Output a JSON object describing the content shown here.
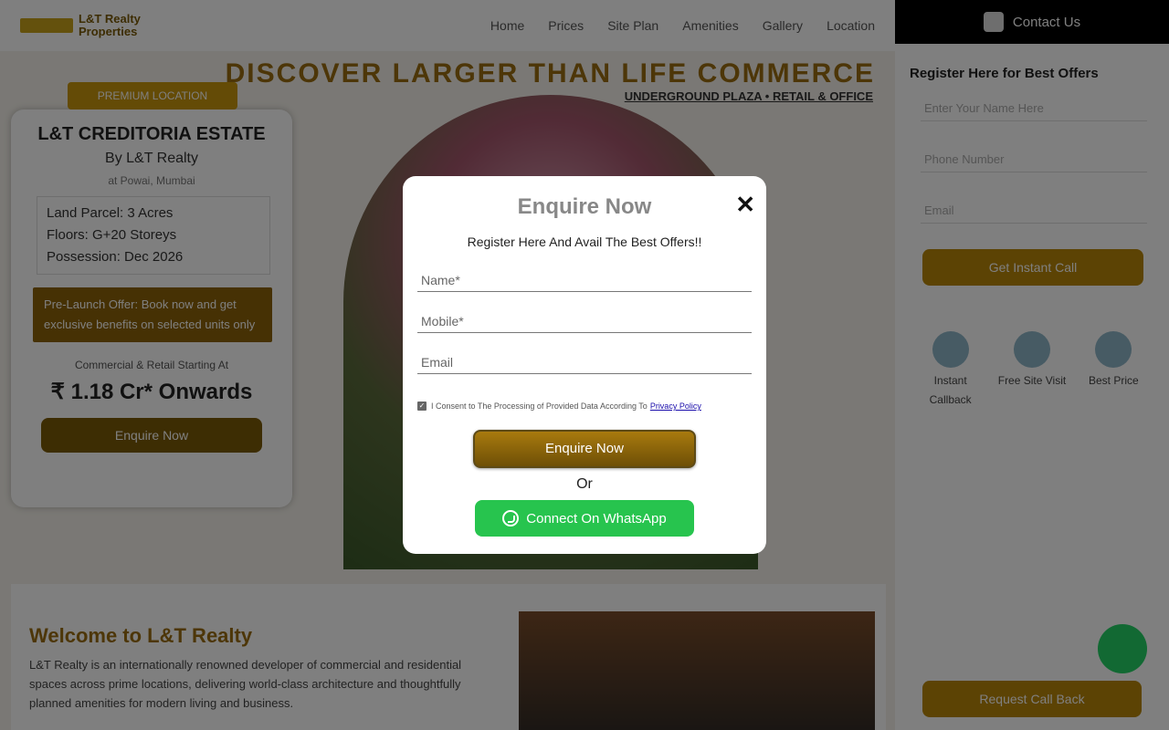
{
  "background": {
    "nav": {
      "logo_text": "L&T Realty\nProperties",
      "links": [
        "Home",
        "Prices",
        "Site Plan",
        "Amenities",
        "Gallery",
        "Location"
      ]
    },
    "hero": {
      "title": "DISCOVER LARGER THAN LIFE COMMERCE",
      "subtitle": "UNDERGROUND PLAZA • RETAIL & OFFICE"
    },
    "card": {
      "tag": "PREMIUM LOCATION",
      "title": "L&T CREDITORIA ESTATE",
      "subtitle": "By L&T Realty",
      "location": "at Powai, Mumbai",
      "details": [
        "Land Parcel: 3 Acres",
        "Floors: G+20 Storeys",
        "Possession: Dec 2026"
      ],
      "offer": "Pre-Launch Offer: Book now and get exclusive benefits on selected units only",
      "price_label": "Commercial & Retail Starting At",
      "price": "₹ 1.18 Cr* Onwards",
      "button": "Enquire Now"
    },
    "about": {
      "heading": "Welcome to L&T Realty",
      "text": "L&T Realty is an internationally renowned developer of commercial and residential spaces across prime locations, delivering world-class architecture and thoughtfully planned amenities for modern living and business."
    }
  },
  "side": {
    "header": "Contact Us",
    "heading": "Register Here for Best Offers",
    "name_placeholder": "Enter Your Name Here",
    "phone_placeholder": "Phone Number",
    "email_placeholder": "Email",
    "button": "Get Instant Call",
    "icons": [
      {
        "label": "Instant Callback",
        "icon": "callback-icon"
      },
      {
        "label": "Free Site Visit",
        "icon": "car-icon"
      },
      {
        "label": "Best Price",
        "icon": "tag-icon"
      }
    ],
    "bottom_button": "Request Call Back"
  },
  "modal": {
    "title": "Enquire Now",
    "subtitle": "Register Here And Avail The Best Offers!!",
    "name_placeholder": "Name*",
    "mobile_placeholder": "Mobile*",
    "email_placeholder": "Email",
    "consent_text": "I Consent to The Processing of Provided Data According To",
    "privacy_link": "Privacy Policy",
    "submit_label": "Enquire Now",
    "or_text": "Or",
    "whatsapp_label": "Connect On WhatsApp",
    "close_symbol": "✕"
  },
  "colors": {
    "gold": "#a87a0e",
    "whatsapp_green": "#27c44e",
    "overlay": "rgba(0,0,0,0.5)"
  }
}
